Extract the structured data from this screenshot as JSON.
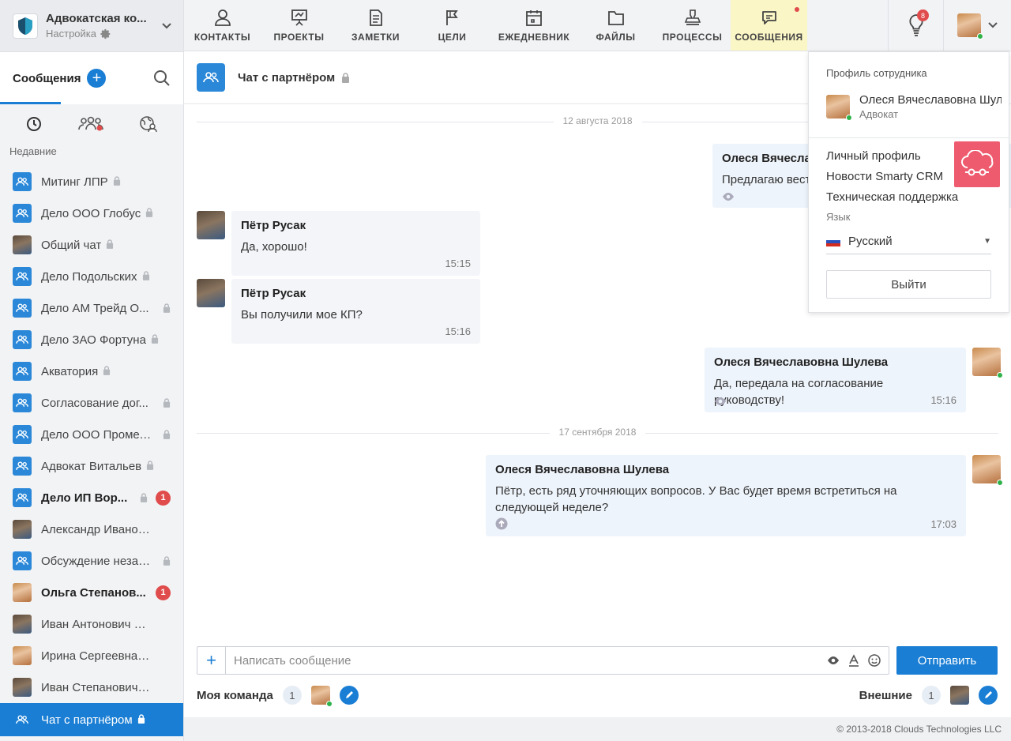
{
  "company": {
    "name": "Адвокатская ко...",
    "settings": "Настройка"
  },
  "nav": [
    {
      "label": "КОНТАКТЫ",
      "icon": "user-icon"
    },
    {
      "label": "ПРОЕКТЫ",
      "icon": "presentation-icon"
    },
    {
      "label": "ЗАМЕТКИ",
      "icon": "note-icon"
    },
    {
      "label": "ЦЕЛИ",
      "icon": "flag-icon"
    },
    {
      "label": "ЕЖЕДНЕВНИК",
      "icon": "calendar-icon"
    },
    {
      "label": "ФАЙЛЫ",
      "icon": "folder-icon"
    },
    {
      "label": "ПРОЦЕССЫ",
      "icon": "stamp-icon"
    },
    {
      "label": "СООБЩЕНИЯ",
      "icon": "chat-bubble-icon",
      "active": true
    }
  ],
  "notifications_count": "8",
  "sidebar": {
    "title": "Сообщения",
    "recent_label": "Недавние",
    "chats": [
      {
        "name": "Митинг ЛПР",
        "lock": true,
        "type": "group"
      },
      {
        "name": "Дело ООО Глобус",
        "lock": true,
        "type": "group"
      },
      {
        "name": "Общий чат",
        "lock": true,
        "type": "photo"
      },
      {
        "name": "Дело Подольских",
        "lock": true,
        "type": "group"
      },
      {
        "name": "Дело АМ Трейд О...",
        "lock": true,
        "type": "group"
      },
      {
        "name": "Дело ЗАО Фортуна",
        "lock": true,
        "type": "group"
      },
      {
        "name": "Акватория",
        "lock": true,
        "type": "group"
      },
      {
        "name": "Согласование дог...",
        "lock": true,
        "type": "group"
      },
      {
        "name": "Дело ООО Промет...",
        "lock": true,
        "type": "group"
      },
      {
        "name": "Адвокат Витальев",
        "lock": true,
        "type": "group"
      },
      {
        "name": "Дело ИП Вор...",
        "lock": true,
        "type": "group",
        "bold": true,
        "badge": "1"
      },
      {
        "name": "Александр Иванович...",
        "lock": false,
        "type": "photo"
      },
      {
        "name": "Обсуждение незак...",
        "lock": true,
        "type": "group"
      },
      {
        "name": "Ольга Степанов...",
        "lock": false,
        "type": "photo",
        "bold": true,
        "badge": "1"
      },
      {
        "name": "Иван Антонович Сер...",
        "lock": false,
        "type": "photo"
      },
      {
        "name": "Ирина Сергеевна Ан...",
        "lock": false,
        "type": "photo"
      },
      {
        "name": "Иван Степанович Гр...",
        "lock": false,
        "type": "photo"
      },
      {
        "name": "Чат с партнёром",
        "lock": true,
        "type": "group",
        "active": true
      }
    ]
  },
  "chat": {
    "title": "Чат с партнёром",
    "date1": "12 августа 2018",
    "date2": "17 сентября 2018",
    "messages": [
      {
        "author": "Олеся Вячесла",
        "text": "Предлагаю вест",
        "time": ""
      },
      {
        "author": "Пётр Русак",
        "text": "Да, хорошо!",
        "time": "15:15"
      },
      {
        "author": "Пётр Русак",
        "text": "Вы получили мое КП?",
        "time": "15:16"
      },
      {
        "author": "Олеся Вячеславовна Шулева",
        "text": "Да, передала на согласование руководству!",
        "time": "15:16"
      },
      {
        "author": "Олеся Вячеславовна Шулева",
        "text": "Пётр, есть ряд уточняющих вопросов. У Вас будет время встретиться на следующей неделе?",
        "time": "17:03"
      }
    ],
    "composer_placeholder": "Написать сообщение",
    "send_label": "Отправить",
    "my_team_label": "Моя команда",
    "my_team_count": "1",
    "external_label": "Внешние",
    "external_count": "1"
  },
  "footer": "© 2013-2018 Clouds Technologies LLC",
  "dropdown": {
    "header": "Профиль сотрудника",
    "name": "Олеся Вячеславовна Шулева",
    "role": "Адвокат",
    "links": [
      "Личный профиль",
      "Новости Smarty CRM",
      "Техническая поддержка"
    ],
    "language_label": "Язык",
    "language": "Русский",
    "logout": "Выйти"
  },
  "colors": {
    "accent": "#1a7ed4",
    "badge": "#e04b4b",
    "active_nav": "#fbf6c6",
    "cloud": "#ee5b6f"
  }
}
